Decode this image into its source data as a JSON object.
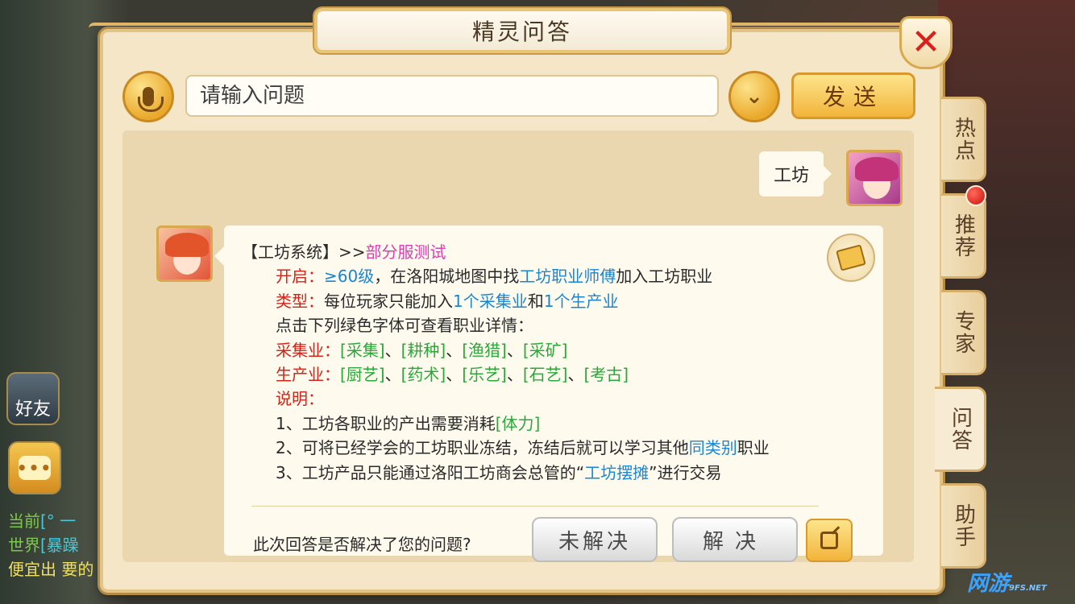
{
  "window": {
    "title": "精灵问答",
    "close_label": "✕"
  },
  "input": {
    "placeholder": "请输入问题",
    "send_label": "发送",
    "dropdown_glyph": "⌄"
  },
  "conversation": {
    "user_message": "工坊",
    "answer": {
      "header_prefix": "【工坊系统】>>",
      "header_tag": "部分服测试",
      "open_label": "开启：",
      "open_level": "≥60级",
      "open_text_1": "，在洛阳城地图中找",
      "open_npc": "工坊职业师傅",
      "open_text_2": "加入工坊职业",
      "type_label": "类型：",
      "type_text_1": "每位玩家只能加入",
      "type_gather": "1个采集业",
      "type_and": "和",
      "type_produce": "1个生产业",
      "hint": "点击下列绿色字体可查看职业详情：",
      "gather_label": "采集业：",
      "gather_items": [
        "[采集]",
        "[耕种]",
        "[渔猎]",
        "[采矿]"
      ],
      "produce_label": "生产业：",
      "produce_items": [
        "[厨艺]",
        "[药术]",
        "[乐艺]",
        "[石艺]",
        "[考古]"
      ],
      "separator": "、",
      "note_label": "说明：",
      "note_1_text": "1、工坊各职业的产出需要消耗",
      "note_1_link": "[体力]",
      "note_2_text_1": "2、可将已经学会的工坊职业冻结，冻结后就可以学习其他",
      "note_2_link": "同类别",
      "note_2_text_2": "职业",
      "note_3_text_1": "3、工坊产品只能通过洛阳工坊商会总管的“",
      "note_3_link": "工坊摆摊",
      "note_3_text_2": "”进行交易"
    },
    "feedback": {
      "question": "此次回答是否解决了您的问题?",
      "unsolved_label": "未解决",
      "solved_label": "解决"
    }
  },
  "side_tabs": [
    {
      "label": "热点",
      "has_notification": false
    },
    {
      "label": "推荐",
      "has_notification": true
    },
    {
      "label": "专家",
      "has_notification": false
    },
    {
      "label": "问答",
      "has_notification": false,
      "active": true
    },
    {
      "label": "助手",
      "has_notification": false
    }
  ],
  "hud": {
    "friends_label": "好友",
    "chat_icon_glyph": "•••",
    "chat_lines": [
      {
        "channel": "当前",
        "text": "[° 一"
      },
      {
        "channel": "世界",
        "text": "[暴躁"
      },
      {
        "channel": "",
        "text": "便宜出 要的"
      }
    ]
  },
  "watermark": {
    "text": "网游",
    "sub": "9FS.NET"
  },
  "colors": {
    "accent_red": "#d1251b",
    "link_blue": "#1a86d0",
    "tag_pink": "#dc3fb2",
    "link_green": "#2aa83a",
    "gold": "#f2b43a"
  }
}
